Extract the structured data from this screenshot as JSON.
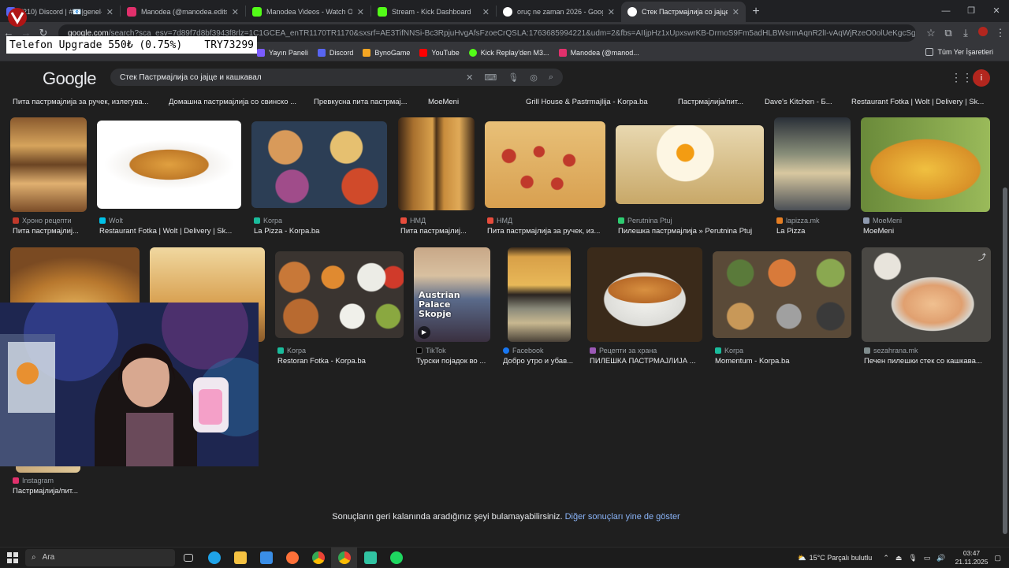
{
  "browser": {
    "tabs": [
      {
        "title": "(210) Discord | #📧|genel-sohb",
        "color": "#5865f2",
        "active": false
      },
      {
        "title": "Manodea (@manodea.edits) • I",
        "color": "#e1306c",
        "active": false
      },
      {
        "title": "Manodea Videos - Watch On-D",
        "color": "#53fc18",
        "active": false
      },
      {
        "title": "Stream - Kick Dashboard",
        "color": "#53fc18",
        "active": false
      },
      {
        "title": "oruç ne zaman 2026 - Google'd",
        "color": "#ffffff",
        "active": false
      },
      {
        "title": "Стек Пастрмајлија со јајце и к",
        "color": "#ffffff",
        "active": true
      }
    ],
    "new_tab": "+",
    "url_domain": "google.com",
    "url_rest": "/search?sca_esv=7d89f7d8bf3943f8rlz=1C1GCEA_enTR1170TR1170&sxsrf=AE3TifNNSi-Bc3RpjuHvgAfsFzoeCrQSLA:1763685994221&udm=2&fbs=AIIjpHz1xUpxswrKB-DrmoS9Fm5adHLBWsrmAqnR2lI-vAqWjRzeO0olUeKgcSghYDS3I6...",
    "bookmarks": [
      {
        "label": "Yayın Paneli",
        "color": "#7b5cff"
      },
      {
        "label": "Discord",
        "color": "#5865f2"
      },
      {
        "label": "BynoGame",
        "color": "#f5a623"
      },
      {
        "label": "YouTube",
        "color": "#ff0000"
      },
      {
        "label": "Kick Replay'den M3...",
        "color": "#53fc18"
      },
      {
        "label": "Manodea (@manod...",
        "color": "#e1306c"
      }
    ],
    "all_bookmarks": "Tüm Yer İşaretleri"
  },
  "overlay": {
    "text": "Telefon Upgrade  550₺ (0.75%)",
    "amount": "TRY73299"
  },
  "google": {
    "logo": "Google",
    "query": "Стек Пастрмајлија со јајце и кашкавал",
    "profile_initial": "i",
    "row0": [
      {
        "title": "Пита пастрмајлија за ручек, излегува..."
      },
      {
        "title": "Домашна пастрмајлија со свинско ..."
      },
      {
        "title": "Превкусна пита пастрмај..."
      },
      {
        "title": "MoeMeni"
      },
      {
        "title": "Grill House & Pastrmajlija - Korpa.ba"
      },
      {
        "title": "Пастрмајлија/пит..."
      },
      {
        "title": "Dave's Kitchen - Б..."
      },
      {
        "title": "Restaurant Fotka | Wolt | Delivery | Sk..."
      }
    ],
    "row1": [
      {
        "source": "Хроно рецепти",
        "title": "Пита пастрмајлиј...",
        "color": "#c0392b"
      },
      {
        "source": "Wolt",
        "title": "Restaurant Fotka | Wolt | Delivery | Sk...",
        "color": "#00c2e8"
      },
      {
        "source": "Korpa",
        "title": "La Pizza - Korpa.ba",
        "color": "#1abc9c"
      },
      {
        "source": "НМД",
        "title": "Пита пастрмајлиј...",
        "color": "#e74c3c"
      },
      {
        "source": "НМД",
        "title": "Пита пастрмајлија за ручек, из...",
        "color": "#e74c3c"
      },
      {
        "source": "Perutnina Ptuj",
        "title": "Пилешка пастрмајлија » Perutnina Ptuj",
        "color": "#2ecc71"
      },
      {
        "source": "lapizza.mk",
        "title": "La Pizza",
        "color": "#e67e22"
      },
      {
        "source": "MoeMeni",
        "title": "MoeMeni",
        "color": "#8e9aaf"
      }
    ],
    "row2": [
      {
        "source": "Korpa",
        "title": "Restoran Fotka - Korpa.ba",
        "color": "#1abc9c"
      },
      {
        "source": "TikTok",
        "title": "Турски појадок во ...",
        "color": "#000000"
      },
      {
        "source": "Facebook",
        "title": "Добро утро и убав...",
        "color": "#1877f2"
      },
      {
        "source": "Рецепти за храна",
        "title": "ПИЛЕШКА ПАСТРМАЈЛИЈА ...",
        "color": "#9b59b6"
      },
      {
        "source": "Korpa",
        "title": "Momentum - Korpa.ba",
        "color": "#1abc9c"
      },
      {
        "source": "sezahrana.mk",
        "title": "Печен пилешки стек со кашкава...",
        "color": "#7f8c8d"
      }
    ],
    "row3": [
      {
        "source": "Instagram",
        "title": "Пастрмајлија/пит...",
        "color": "#e1306c"
      }
    ],
    "video_overlay_text": "Austrian Palace Skopje",
    "no_results_msg": "Sonuçların geri kalanında aradığınız şeyi bulamayabilirsiniz.",
    "show_more": "Diğer sonuçları yine de göster"
  },
  "taskbar": {
    "search_placeholder": "Ara",
    "weather": "15°C  Parçalı bulutlu",
    "time": "03:47",
    "date": "21.11.2025"
  }
}
